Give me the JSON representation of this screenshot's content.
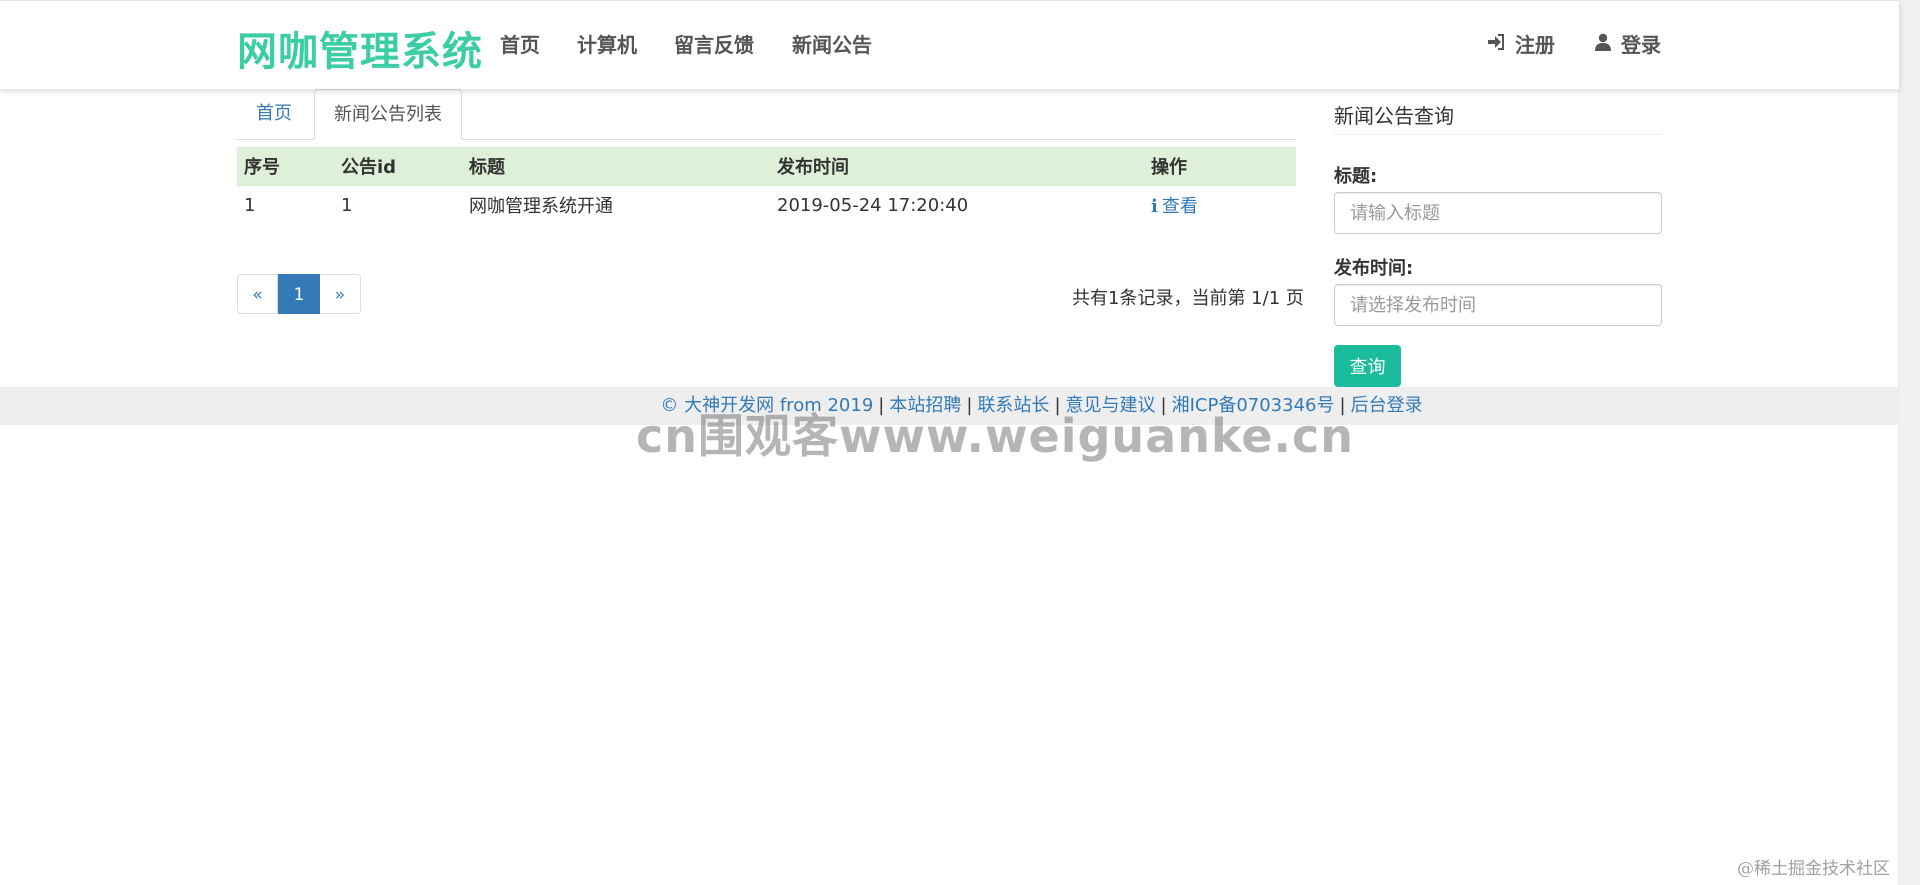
{
  "navbar": {
    "brand": "网咖管理系统",
    "links": [
      "首页",
      "计算机",
      "留言反馈",
      "新闻公告"
    ],
    "register": "注册",
    "login": "登录"
  },
  "tabs": [
    "首页",
    "新闻公告列表"
  ],
  "table": {
    "headers": [
      "序号",
      "公告id",
      "标题",
      "发布时间",
      "操作"
    ],
    "rows": [
      [
        "1",
        "1",
        "网咖管理系统开通",
        "2019-05-24 17:20:40",
        "查看"
      ]
    ]
  },
  "pagination": {
    "prev": "«",
    "current": "1",
    "next": "»",
    "info": "共有1条记录，当前第 1/1 页"
  },
  "search": {
    "title": "新闻公告查询",
    "title_label": "标题:",
    "title_placeholder": "请输入标题",
    "time_label": "发布时间:",
    "time_placeholder": "请选择发布时间",
    "button": "查询"
  },
  "footer": {
    "links": [
      "© 大神开发网 from 2019",
      "本站招聘",
      "联系站长",
      "意见与建议",
      "湘ICP备0703346号",
      "后台登录"
    ],
    "separator": "|"
  },
  "watermark": "cn围观客www.weiguanke.cn",
  "corner_mark": "@稀土掘金技术社区",
  "colors": {
    "brand": "#3ccda5",
    "link": "#337ab7",
    "table_header": "#dff0d8",
    "search_button": "#1abc9c"
  }
}
